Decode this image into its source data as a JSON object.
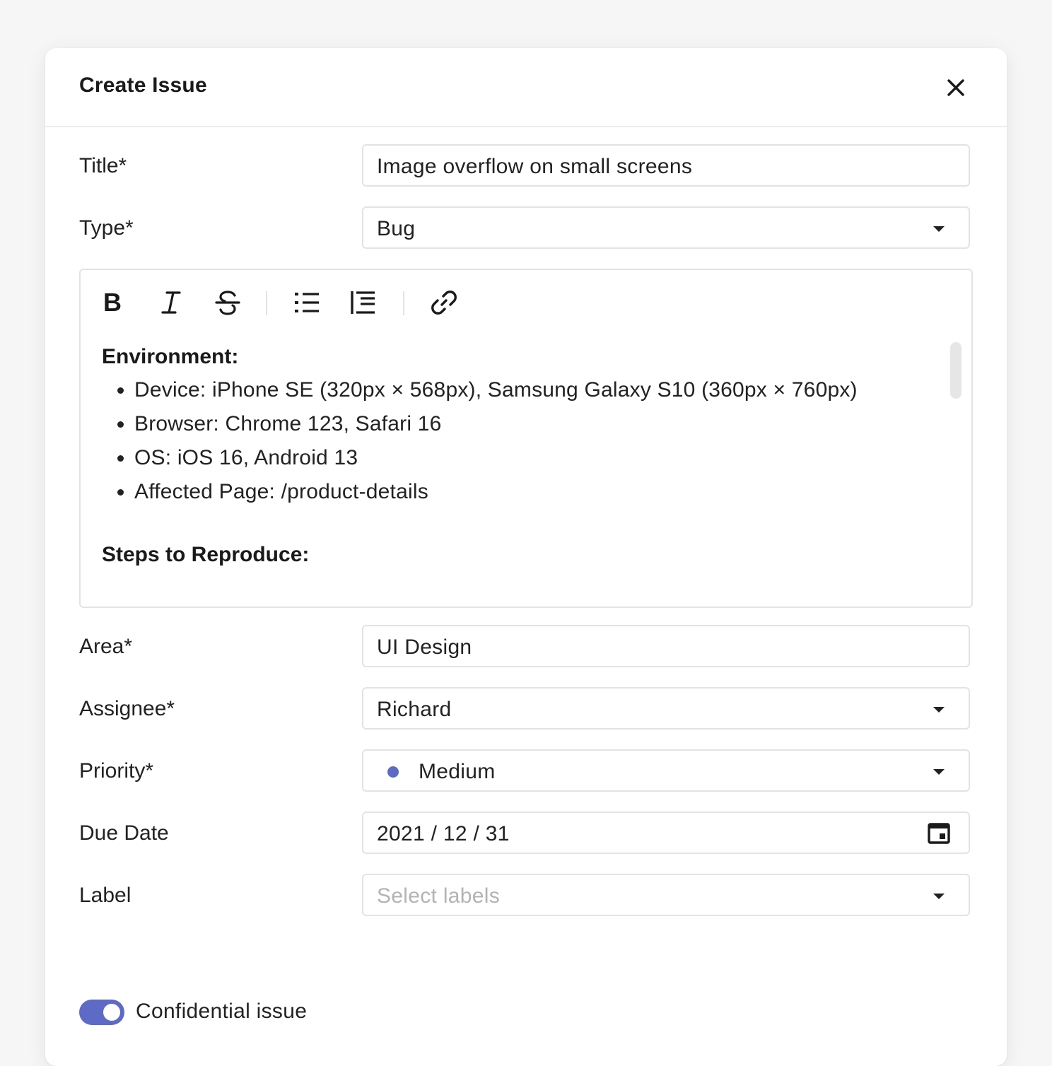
{
  "modal": {
    "title": "Create Issue"
  },
  "form": {
    "title": {
      "label": "Title*",
      "value": "Image overflow on small screens"
    },
    "type": {
      "label": "Type*",
      "value": "Bug"
    },
    "area": {
      "label": "Area*",
      "value": "UI Design"
    },
    "assignee": {
      "label": "Assignee*",
      "value": "Richard"
    },
    "priority": {
      "label": "Priority*",
      "value": "Medium",
      "dot_color": "#5d6ac6"
    },
    "due_date": {
      "label": "Due Date",
      "value": "2021 / 12 / 31"
    },
    "label": {
      "label": "Label",
      "placeholder": "Select labels"
    }
  },
  "editor": {
    "toolbar": [
      "bold-icon",
      "italic-icon",
      "strikethrough-icon",
      "bullet-list-icon",
      "numbered-list-icon",
      "link-icon"
    ],
    "heading1": "Environment:",
    "items": [
      "Device: iPhone SE (320px × 568px), Samsung Galaxy S10 (360px × 760px)",
      "Browser: Chrome 123, Safari 16",
      "OS: iOS 16, Android 13",
      "Affected Page: /product-details"
    ],
    "heading2": "Steps to Reproduce:"
  },
  "confidential": {
    "label": "Confidential issue",
    "enabled": true,
    "color": "#5d6ac6"
  }
}
